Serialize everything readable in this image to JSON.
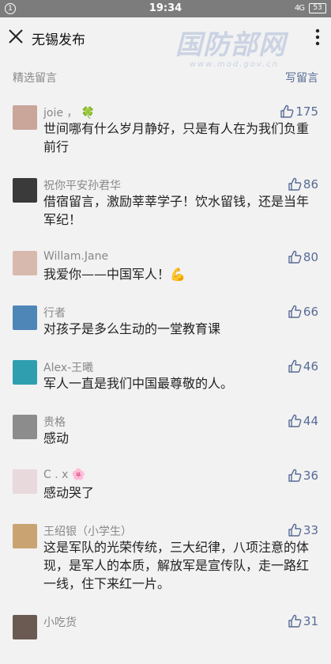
{
  "status": {
    "notif_badge": "1",
    "time": "19:34",
    "signal": "4G",
    "battery": "53"
  },
  "nav": {
    "title": "无锡发布"
  },
  "watermark": {
    "main": "国防部网",
    "url": "www.mod.gov.cn"
  },
  "section": {
    "label": "精选留言",
    "write_label": "写留言"
  },
  "comments": [
    {
      "name": "joie ，",
      "emoji": "🍀",
      "likes": "175",
      "text": "世间哪有什么岁月静好，只是有人在为我们负重前行",
      "avatar": "#c9a59a"
    },
    {
      "name": "祝你平安孙君华",
      "emoji": "",
      "likes": "86",
      "text": "借宿留言，激励莘莘学子！饮水留钱，还是当年军纪！",
      "avatar": "#3a3a3a"
    },
    {
      "name": "Willam.Jane",
      "emoji": "",
      "likes": "80",
      "text": "我爱你——中国军人！💪",
      "avatar": "#d8b9ad"
    },
    {
      "name": "行者",
      "emoji": "",
      "likes": "66",
      "text": "对孩子是多么生动的一堂教育课",
      "avatar": "#4f86b8"
    },
    {
      "name": "Alex-王曦",
      "emoji": "",
      "likes": "46",
      "text": "军人一直是我们中国最尊敬的人。",
      "avatar": "#2f9fb0"
    },
    {
      "name": "贵格",
      "emoji": "",
      "likes": "44",
      "text": "感动",
      "avatar": "#8c8c8c"
    },
    {
      "name": "C . x",
      "emoji": "🌸",
      "likes": "36",
      "text": "感动哭了",
      "avatar": "#e8d9dd"
    },
    {
      "name": "王绍银（小学生）",
      "emoji": "",
      "likes": "33",
      "text": "这是军队的光荣传统，三大纪律，八项注意的体现，是军人的本质，解放军是宣传队，走一路红一线，住下来红一片。",
      "avatar": "#c9a472"
    },
    {
      "name": "小吃货",
      "emoji": "",
      "likes": "31",
      "text": "",
      "avatar": "#6b5a52"
    }
  ]
}
